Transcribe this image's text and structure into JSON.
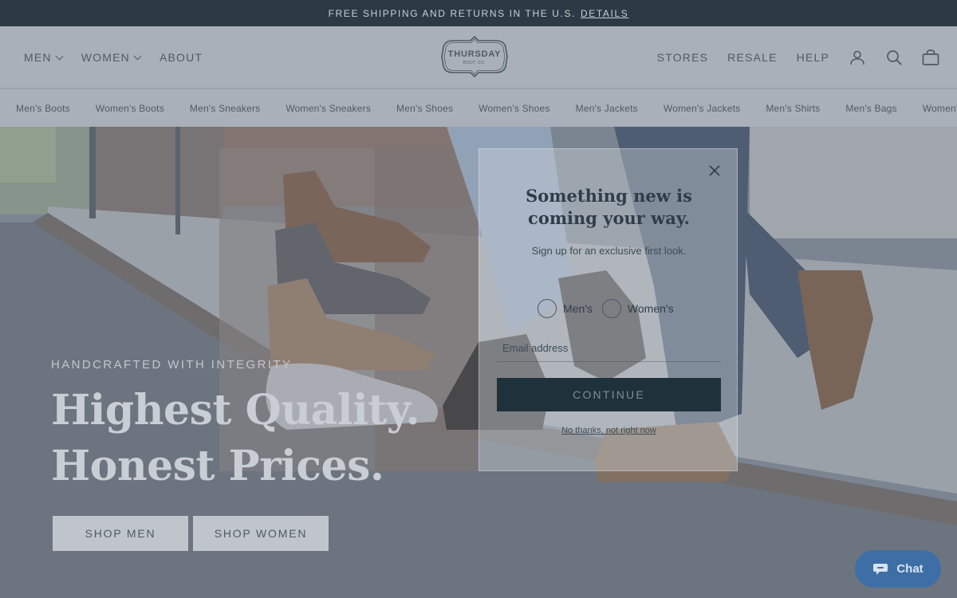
{
  "announcement": {
    "text": "FREE SHIPPING AND RETURNS IN THE U.S.",
    "link": "DETAILS"
  },
  "header": {
    "nav_left": [
      {
        "label": "MEN",
        "has_dropdown": true
      },
      {
        "label": "WOMEN",
        "has_dropdown": true
      },
      {
        "label": "ABOUT",
        "has_dropdown": false
      }
    ],
    "logo": {
      "line1": "THURSDAY",
      "line2": "BOOT CO."
    },
    "nav_right": [
      "STORES",
      "RESALE",
      "HELP"
    ],
    "icons": [
      "account-icon",
      "search-icon",
      "bag-icon"
    ]
  },
  "categories": [
    "Men's Boots",
    "Women's Boots",
    "Men's Sneakers",
    "Women's Sneakers",
    "Men's Shoes",
    "Women's Shoes",
    "Men's Jackets",
    "Women's Jackets",
    "Men's Shirts",
    "Men's Bags",
    "Women's"
  ],
  "hero": {
    "eyebrow": "HANDCRAFTED WITH INTEGRITY",
    "headline_line1": "Highest Quality.",
    "headline_line2": "Honest Prices.",
    "buttons": [
      "SHOP MEN",
      "SHOP WOMEN"
    ]
  },
  "modal": {
    "title": "Something new is coming your way.",
    "subtitle": "Sign up for an exclusive first look.",
    "options": [
      "Men's",
      "Women's"
    ],
    "email_placeholder": "Email address",
    "email_value": "",
    "continue_label": "CONTINUE",
    "dismiss_label": "No thanks, not right now"
  },
  "chat": {
    "label": "Chat"
  },
  "colors": {
    "announcement_bg": "#2b3a44",
    "header_bg": "#b3b9c0",
    "text_dark": "#2c3a45",
    "continue_bg": "#1f313b",
    "chat_bg": "#3d6fa6"
  }
}
